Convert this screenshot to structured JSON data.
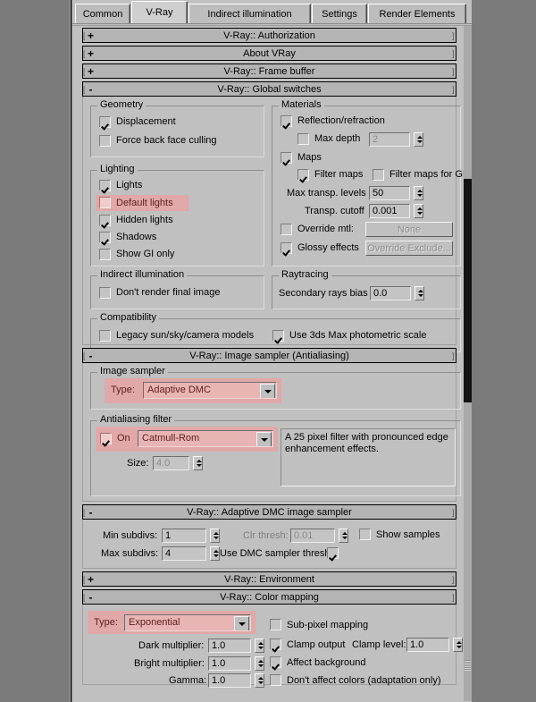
{
  "window": {
    "tabs": [
      {
        "label": "Common",
        "active": false
      },
      {
        "label": "V-Ray",
        "active": true
      },
      {
        "label": "Indirect illumination",
        "active": false
      },
      {
        "label": "Settings",
        "active": false
      },
      {
        "label": "Render Elements",
        "active": false
      }
    ]
  },
  "colors": {
    "panel_bg": "#c0c0c0",
    "desktop_bg": "#7b7b7b",
    "highlight_pink": "#e0a8a8",
    "highlight_text": "#5c1f1f",
    "dropdown_fill": "#e8b4b4"
  },
  "rollouts": {
    "authorization": {
      "title": "V-Ray:: Authorization",
      "state": "+"
    },
    "about": {
      "title": "About VRay",
      "state": "+"
    },
    "frame_buffer": {
      "title": "V-Ray:: Frame buffer",
      "state": "+"
    },
    "global_switches": {
      "title": "V-Ray:: Global switches",
      "state": "-",
      "groups": {
        "geometry": {
          "caption": "Geometry",
          "items": [
            {
              "label": "Displacement",
              "checked": true,
              "enabled": true,
              "highlight": false
            },
            {
              "label": "Force back face culling",
              "checked": false,
              "enabled": true,
              "highlight": false
            }
          ]
        },
        "lighting": {
          "caption": "Lighting",
          "items": [
            {
              "label": "Lights",
              "checked": true,
              "enabled": true,
              "highlight": false
            },
            {
              "label": "Default lights",
              "checked": false,
              "enabled": true,
              "highlight": true
            },
            {
              "label": "Hidden lights",
              "checked": true,
              "enabled": true,
              "highlight": false
            },
            {
              "label": "Shadows",
              "checked": true,
              "enabled": true,
              "highlight": false
            },
            {
              "label": "Show GI only",
              "checked": false,
              "enabled": true,
              "highlight": false
            }
          ]
        },
        "indirect_illumination": {
          "caption": "Indirect illumination",
          "items": [
            {
              "label": "Don't render final image",
              "checked": false,
              "enabled": true,
              "highlight": false
            }
          ]
        },
        "materials": {
          "caption": "Materials",
          "reflection_refraction": {
            "label": "Reflection/refraction",
            "checked": true
          },
          "max_depth": {
            "label": "Max depth",
            "checked": false,
            "value": "2",
            "enabled": false
          },
          "maps": {
            "label": "Maps",
            "checked": true
          },
          "filter_maps": {
            "label": "Filter maps",
            "checked": true
          },
          "filter_maps_gi": {
            "label": "Filter maps for GI",
            "checked": false
          },
          "max_transp_levels": {
            "label": "Max transp. levels",
            "value": "50"
          },
          "transp_cutoff": {
            "label": "Transp. cutoff",
            "value": "0.001"
          },
          "override_mtl": {
            "label": "Override mtl:",
            "checked": false,
            "button": "None",
            "enabled": false
          },
          "glossy_effects": {
            "label": "Glossy effects",
            "checked": true,
            "button": "Override Exclude...",
            "enabled": false
          }
        },
        "raytracing": {
          "caption": "Raytracing",
          "secondary_rays_bias": {
            "label": "Secondary rays bias",
            "value": "0.0"
          }
        },
        "compatibility": {
          "caption": "Compatibility",
          "items": [
            {
              "label": "Legacy sun/sky/camera models",
              "checked": false
            },
            {
              "label": "Use 3ds Max photometric scale",
              "checked": true
            }
          ]
        }
      }
    },
    "image_sampler": {
      "title": "V-Ray:: Image sampler (Antialiasing)",
      "state": "-",
      "sampler_group": {
        "caption": "Image sampler",
        "type_label": "Type:",
        "type_value": "Adaptive DMC"
      },
      "filter_group": {
        "caption": "Antialiasing filter",
        "on_label": "On",
        "on_checked": true,
        "filter_value": "Catmull-Rom",
        "size_label": "Size:",
        "size_value": "4.0",
        "size_enabled": false,
        "description": "A 25 pixel filter with pronounced edge enhancement effects."
      }
    },
    "adaptive_dmc": {
      "title": "V-Ray:: Adaptive DMC image sampler",
      "state": "-",
      "min_subdivs": {
        "label": "Min subdivs:",
        "value": "1"
      },
      "max_subdivs": {
        "label": "Max subdivs:",
        "value": "4"
      },
      "clr_thresh": {
        "label": "Clr thresh:",
        "value": "0.01",
        "enabled": false
      },
      "use_dmc_sampler_thresh": {
        "label": "Use DMC sampler thresh.",
        "checked": true
      },
      "show_samples": {
        "label": "Show samples",
        "checked": false
      }
    },
    "environment": {
      "title": "V-Ray:: Environment",
      "state": "+"
    },
    "color_mapping": {
      "title": "V-Ray:: Color mapping",
      "state": "-",
      "type_label": "Type:",
      "type_value": "Exponential",
      "dark_multiplier": {
        "label": "Dark multiplier:",
        "value": "1.0"
      },
      "bright_multiplier": {
        "label": "Bright multiplier:",
        "value": "1.0"
      },
      "gamma": {
        "label": "Gamma:",
        "value": "1.0"
      },
      "sub_pixel_mapping": {
        "label": "Sub-pixel mapping",
        "checked": false
      },
      "clamp_output": {
        "label": "Clamp output",
        "checked": true
      },
      "clamp_level": {
        "label": "Clamp level:",
        "value": "1.0"
      },
      "affect_background": {
        "label": "Affect background",
        "checked": true
      },
      "dont_affect_colors": {
        "label": "Don't affect colors (adaptation only)",
        "checked": false
      }
    }
  }
}
